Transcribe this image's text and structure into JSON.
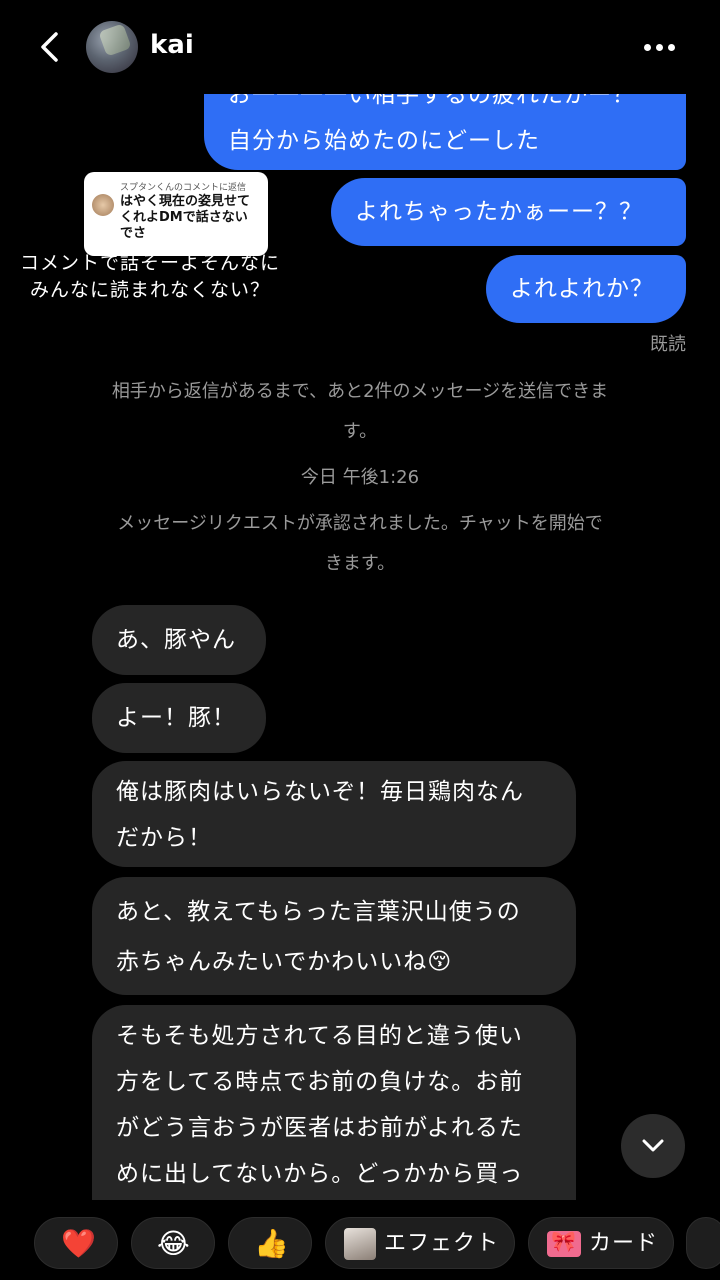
{
  "header": {
    "username": "kai",
    "back_icon": "chevron-left-icon",
    "more_icon": "more-horizontal-icon"
  },
  "reply_sticker": {
    "heading": "スプタンくんのコメントに返信",
    "text": "はやく現在の姿見せてくれよDMで話さないでさ"
  },
  "overlay_caption": {
    "line1": "コメントで話そーよそんなに",
    "line2": "みんなに読まれなくない？"
  },
  "sent_messages": [
    {
      "lines": [
        "お一一一一い相手するの疲れたかー？",
        "自分から始めたのにどーした"
      ]
    },
    {
      "lines": [
        "よれちゃったかぁーー？？"
      ]
    },
    {
      "lines": [
        "よれよれか？"
      ]
    }
  ],
  "seen_label": "既読",
  "system": {
    "limit_notice": [
      "相手から返信があるまで、あと2件のメッセージを送信できま",
      "す。"
    ],
    "timestamp": "今日 午後1:26",
    "accepted_notice": [
      "メッセージリクエストが承認されました。チャットを開始で",
      "きます。"
    ]
  },
  "received_messages": [
    {
      "lines": [
        "あ、豚やん"
      ]
    },
    {
      "lines": [
        "よー！豚！"
      ]
    },
    {
      "lines": [
        "俺は豚肉はいらないぞ！毎日鶏肉なん",
        "だから！"
      ]
    },
    {
      "lines": [
        "あと、教えてもらった言葉沢山使うの",
        "赤ちゃんみたいでかわいいね😚"
      ]
    },
    {
      "lines": [
        "そもそも処方されてる目的と違う使い",
        "方をしてる時点でお前の負けな。お前",
        "がどう言おうが医者はお前がよれるた",
        "めに出してないから。どっかから買っ"
      ]
    }
  ],
  "scroll_down_icon": "chevron-down-icon",
  "quick_bar": {
    "heart": "❤️",
    "laugh": "😂",
    "thumbs": "👍",
    "effect_label": "エフェクト",
    "card_label": "カード"
  }
}
